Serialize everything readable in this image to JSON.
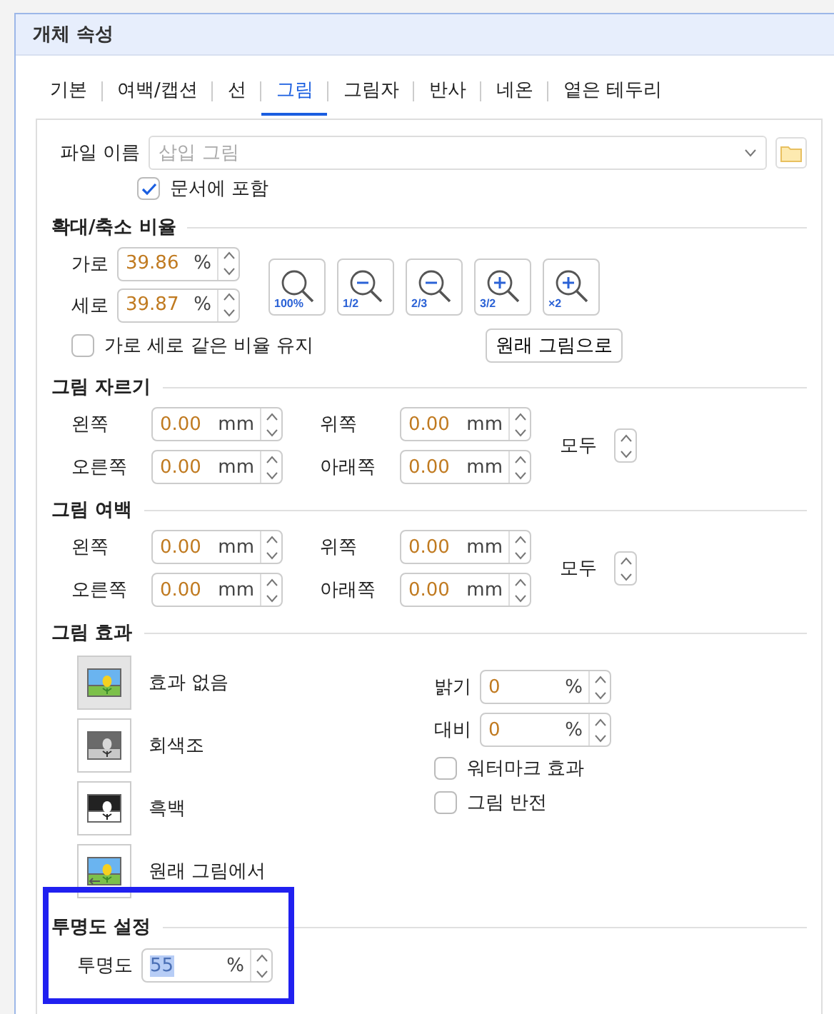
{
  "dialog": {
    "title": "개체 속성"
  },
  "tabs": [
    {
      "label": "기본",
      "selected": false
    },
    {
      "label": "여백/캡션",
      "selected": false
    },
    {
      "label": "선",
      "selected": false
    },
    {
      "label": "그림",
      "selected": true
    },
    {
      "label": "그림자",
      "selected": false
    },
    {
      "label": "반사",
      "selected": false
    },
    {
      "label": "네온",
      "selected": false
    },
    {
      "label": "옅은 테두리",
      "selected": false
    }
  ],
  "file": {
    "label": "파일 이름",
    "placeholder": "삽입 그림",
    "include": {
      "label": "문서에 포함",
      "checked": true
    }
  },
  "scale": {
    "title": "확대/축소 비율",
    "fields": [
      {
        "label": "가로",
        "value": "39.86",
        "unit": "%"
      },
      {
        "label": "세로",
        "value": "39.87",
        "unit": "%"
      }
    ],
    "zoom_buttons": [
      {
        "label": "100%",
        "kind": "plain"
      },
      {
        "label": "1/2",
        "kind": "minus"
      },
      {
        "label": "2/3",
        "kind": "minus"
      },
      {
        "label": "3/2",
        "kind": "plus"
      },
      {
        "label": "×2",
        "kind": "plus"
      }
    ],
    "keep_ratio": {
      "label": "가로 세로 같은 비율 유지",
      "checked": false
    },
    "reset_button": "원래 그림으로"
  },
  "crop": {
    "title": "그림 자르기",
    "fields": [
      {
        "label": "왼쪽",
        "value": "0.00",
        "unit": "mm"
      },
      {
        "label": "위쪽",
        "value": "0.00",
        "unit": "mm"
      },
      {
        "label": "오른쪽",
        "value": "0.00",
        "unit": "mm"
      },
      {
        "label": "아래쪽",
        "value": "0.00",
        "unit": "mm"
      }
    ],
    "all_label": "모두"
  },
  "margin": {
    "title": "그림 여백",
    "fields": [
      {
        "label": "왼쪽",
        "value": "0.00",
        "unit": "mm"
      },
      {
        "label": "위쪽",
        "value": "0.00",
        "unit": "mm"
      },
      {
        "label": "오른쪽",
        "value": "0.00",
        "unit": "mm"
      },
      {
        "label": "아래쪽",
        "value": "0.00",
        "unit": "mm"
      }
    ],
    "all_label": "모두"
  },
  "effects": {
    "title": "그림 효과",
    "items": [
      {
        "label": "효과 없음",
        "kind": "color",
        "selected": true
      },
      {
        "label": "회색조",
        "kind": "gray",
        "selected": false
      },
      {
        "label": "흑백",
        "kind": "bw",
        "selected": false
      },
      {
        "label": "원래 그림에서",
        "kind": "original",
        "selected": false
      }
    ],
    "adjust": [
      {
        "label": "밝기",
        "value": "0",
        "unit": "%"
      },
      {
        "label": "대비",
        "value": "0",
        "unit": "%"
      }
    ],
    "options": [
      {
        "label": "워터마크 효과",
        "checked": false
      },
      {
        "label": "그림 반전",
        "checked": false
      }
    ]
  },
  "transparency": {
    "title": "투명도 설정",
    "label": "투명도",
    "value": "55",
    "unit": "%",
    "value_selected": true,
    "highlighted": true
  }
}
